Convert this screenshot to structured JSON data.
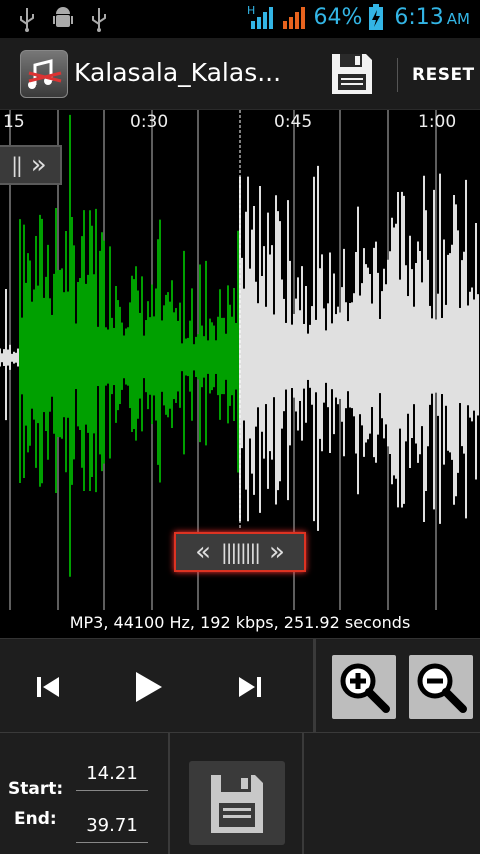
{
  "status_bar": {
    "battery_percent": "64%",
    "time": "6:13",
    "ampm": "AM",
    "network": "H",
    "icons": [
      "usb-icon",
      "android-debug-icon",
      "usb-icon",
      "signal-icon",
      "battery-charging-icon"
    ]
  },
  "action_bar": {
    "title": "Kalasala_Kalas...",
    "reset_label": "RESET",
    "icons": [
      "ringdroid-app-icon",
      "save-icon"
    ]
  },
  "waveform": {
    "time_ticks": [
      "15",
      "0:30",
      "0:45",
      "1:00"
    ],
    "file_info": "MP3, 44100 Hz, 192 kbps, 251.92 seconds",
    "colors": {
      "selected": "#00a000",
      "unselected": "#e0e0e0",
      "background": "#000000"
    }
  },
  "controls": {
    "icons": [
      "previous-icon",
      "play-icon",
      "next-icon",
      "zoom-in-icon",
      "zoom-out-icon"
    ]
  },
  "bottom": {
    "start_label": "Start:",
    "end_label": "End:",
    "start_value": "14.21",
    "end_value": "39.71",
    "icons": [
      "save-icon"
    ]
  }
}
